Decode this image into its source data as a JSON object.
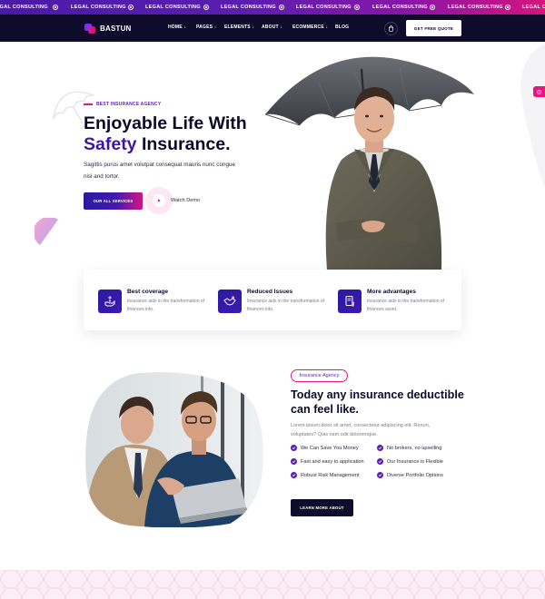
{
  "ticker": {
    "items": [
      "LEGAL CONSULTING",
      "LEGAL CONSULTING",
      "LEGAL CONSULTING",
      "LEGAL CONSULTING",
      "LEGAL CONSULTING",
      "LEGAL CONSULTING",
      "LEGAL CONSULTING",
      "LEGAL CONSULTING"
    ]
  },
  "header": {
    "logo": "BASTUN",
    "nav": [
      {
        "label": "HOME ↓"
      },
      {
        "label": "PAGES ↓"
      },
      {
        "label": "ELEMENTS ↓"
      },
      {
        "label": "ABOUT ↓"
      },
      {
        "label": "ECOMMERCE ↓"
      },
      {
        "label": "BLOG"
      }
    ],
    "cart_icon": "cart-icon",
    "quote_label": "GET FREE QUOTE"
  },
  "hero": {
    "eyebrow": "BEST INSURANCE AGENCY",
    "title_line1": "Enjoyable Life With",
    "title_accent": "Safety",
    "title_rest": " Insurance.",
    "description": "Sagittis purus amet volutpat consequat mauris nunc congue nisi and tortor.",
    "services_label": "OUR ALL SERVICES",
    "demo_label": "Watch Demo"
  },
  "features": [
    {
      "title": "Best coverage",
      "desc": "Insurance aids in the transformation of finances into.",
      "icon": "hand-coins-icon"
    },
    {
      "title": "Reduced Issues",
      "desc": "Insurance aids in the transformation of finances into.",
      "icon": "handshake-icon"
    },
    {
      "title": "More advantages",
      "desc": "Insurance aids in the transformation of finances asset.",
      "icon": "document-shield-icon"
    }
  ],
  "about": {
    "pill": "Insurance Agency",
    "title": "Today any insurance deductible can feel like.",
    "description": "Lorem ipsum dolor sit amet, consectetur adipiscing elit. Rerum, voluptates? Quis nam odit doloremque.",
    "checks": [
      "We Can Save You Money",
      "No brokers, no upselling",
      "Fast and easy to application",
      "Our Insurance is Flexible",
      "Robust Risk Management",
      "Diverse Portfolio Options"
    ],
    "learn_label": "LEARN MORE ABOUT"
  },
  "colors": {
    "primary": "#3d16a8",
    "accent": "#e6177f",
    "dark": "#0e0b2b"
  }
}
